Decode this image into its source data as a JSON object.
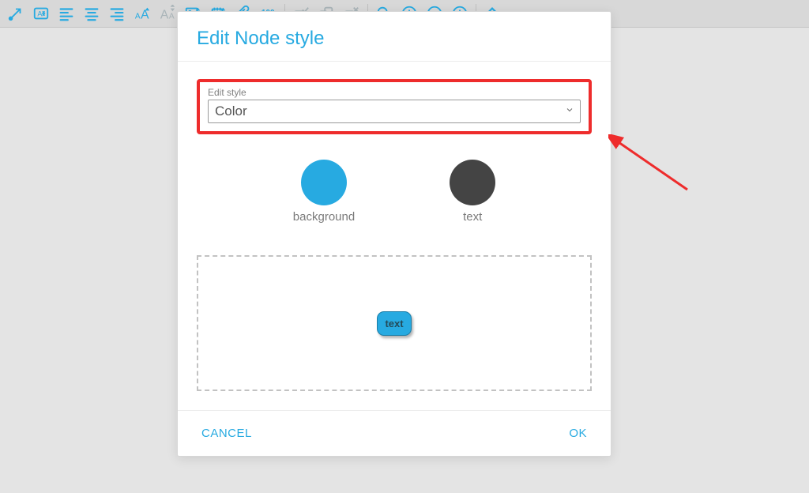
{
  "toolbar": {
    "icons": [
      "arrow-expand-icon",
      "text-card-icon",
      "align-left-icon",
      "align-center-icon",
      "align-right-icon",
      "font-increase-icon",
      "font-decrease-icon",
      "image-icon",
      "note-icon",
      "attachment-icon",
      "hundred-icon",
      "sep",
      "rect-check-icon",
      "rect-group-icon",
      "rect-cross-icon",
      "sep",
      "search-icon",
      "zoom-in-icon",
      "zoom-out-icon",
      "zoom-fit-icon",
      "sep",
      "collapse-up-icon"
    ]
  },
  "dialog": {
    "title": "Edit Node style",
    "edit_style_label": "Edit style",
    "edit_style_value": "Color",
    "swatches": {
      "background": {
        "label": "background",
        "color": "#27aae1"
      },
      "text": {
        "label": "text",
        "color": "#444444"
      }
    },
    "preview_text": "text",
    "buttons": {
      "cancel": "CANCEL",
      "ok": "OK"
    }
  },
  "colors": {
    "accent": "#27aae1",
    "highlight": "#ee2c2c"
  }
}
